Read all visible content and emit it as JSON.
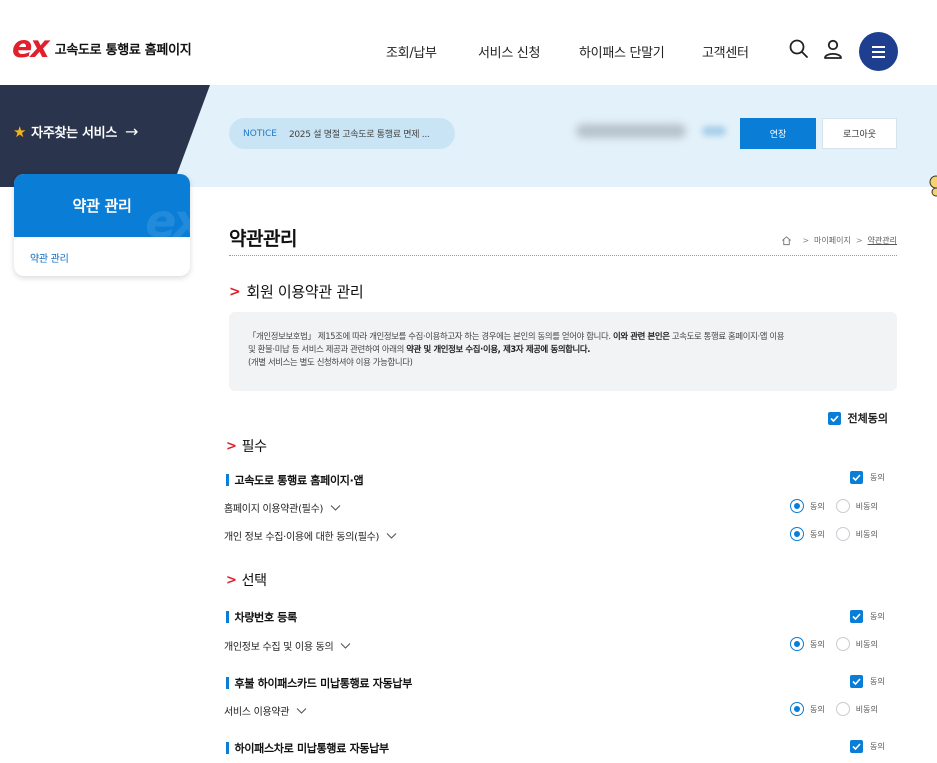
{
  "header": {
    "logo_mark": "ex",
    "logo_text": "고속도로 통행료 홈페이지",
    "nav": [
      "조회/납부",
      "서비스 신청",
      "하이패스 단말기",
      "고객센터"
    ],
    "icons": [
      "search-icon",
      "user-icon",
      "hamburger-menu-icon"
    ]
  },
  "band": {
    "favorites_label": "자주찾는 서비스",
    "favorites_arrow": "→",
    "notice_tag": "NOTICE",
    "notice_text": "2025 설 명절 고속도로 통행료 면제 ...",
    "extend_button": "연장",
    "logout_button": "로그아웃"
  },
  "sidebar": {
    "title": "약관 관리",
    "items": [
      {
        "label": "약관 관리"
      }
    ]
  },
  "main": {
    "title": "약관관리",
    "breadcrumb": [
      "마이페이지",
      "약관관리"
    ],
    "section_title": "회원 이용약관 관리",
    "info": {
      "line1_a": "「개인정보보호법」 제15조에 따라 개인정보를 수집·이용하고자 하는 경우에는 본인의 동의를 얻어야 합니다. ",
      "line1_b": "이와 관련 본인은",
      "line1_c": " 고속도로 통행료 홈페이지·앱 이용",
      "line2_a": "및 환불·미납 등 서비스 제공과 관련하여 아래의 ",
      "line2_b": "약관 및 개인정보 수집·이용, 제3자 제공에 동의합니다.",
      "line3": "(개별 서비스는 별도 신청하셔야 이용 가능합니다)"
    },
    "all_agree_label": "전체동의",
    "agree_label": "동의",
    "disagree_label": "비동의",
    "required": {
      "heading": "필수",
      "groups": [
        {
          "title": "고속도로 통행료 홈페이지·앱",
          "terms": [
            "홈페이지 이용약관(필수)",
            "개인 정보 수집·이용에 대한 동의(필수)"
          ]
        }
      ]
    },
    "optional": {
      "heading": "선택",
      "groups": [
        {
          "title": "차량번호 등록",
          "terms": [
            "개인정보 수집 및 이용 동의"
          ]
        },
        {
          "title": "후불 하이패스카드 미납통행료 자동납부",
          "terms": [
            "서비스 이용약관"
          ]
        },
        {
          "title": "하이패스차로 미납통행료 자동납부",
          "terms": []
        }
      ]
    }
  },
  "colors": {
    "brand_red": "#e0202c",
    "primary_blue": "#0a7dd6",
    "navy": "#1e3f8f",
    "dark_band": "#2a344c",
    "light_band": "#e3f1fa"
  }
}
